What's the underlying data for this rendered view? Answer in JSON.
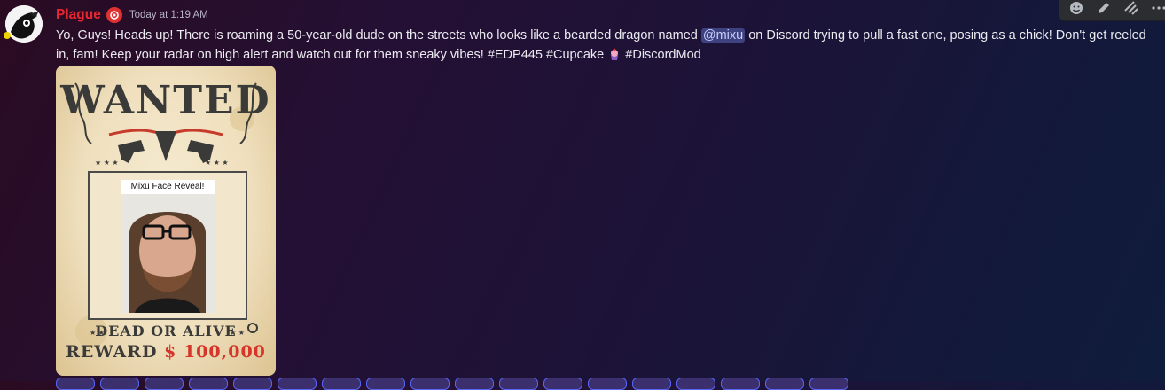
{
  "author": {
    "name": "Plague",
    "timestamp": "Today at 1:19 AM",
    "name_color": "#e8262f"
  },
  "message": {
    "text_before_mention": "Yo, Guys! Heads up! There is roaming a 50-year-old dude on the streets who looks like a bearded dragon named ",
    "mention": "@mixu",
    "text_after_mention": " on Discord trying to pull a fast one, posing as a chick! Don't get reeled in, fam! Keep your radar on high alert and watch out for them sneaky vibes! #EDP445 #Cupcake ",
    "text_end": " #DiscordMod"
  },
  "attachment": {
    "heading": "WANTED",
    "photo_caption": "Mixu Face Reveal!",
    "line1": "DEAD OR ALIVE",
    "reward_label": "REWARD",
    "reward_amount": "$ 100,000"
  },
  "toolbar": {
    "icons": [
      "add-reaction-icon",
      "edit-icon",
      "thread-icon",
      "more-icon"
    ]
  },
  "reactions_count_visible": 18
}
